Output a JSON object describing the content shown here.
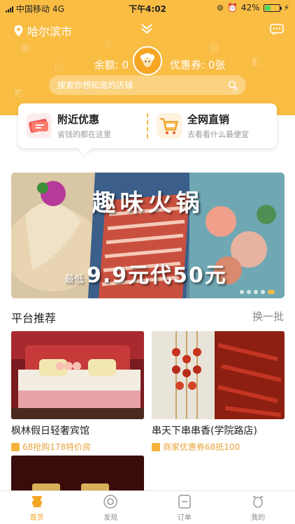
{
  "status_bar": {
    "carrier": "中国移动",
    "network": "4G",
    "time": "下午4:02",
    "battery": "42%",
    "battery_level": 0.42
  },
  "header": {
    "city": "哈尔滨市",
    "balance": "余额: 0",
    "coupons": "优惠券: 0张",
    "search_placeholder": "搜索你想知道的店铺"
  },
  "quick_cards": [
    {
      "title": "附近优惠",
      "subtitle": "省钱的都在这里"
    },
    {
      "title": "全网直销",
      "subtitle": "去看看什么最便宜"
    }
  ],
  "banner": {
    "title": "趣味火锅",
    "sub_prefix": "最低",
    "sub_main": "9.9元代50元"
  },
  "section": {
    "title": "平台推荐",
    "refresh": "换一批"
  },
  "items": [
    {
      "name": "枫林假日轻奢宾馆",
      "promo": "68抢购178特价房"
    },
    {
      "name": "串天下串串香(学院路店)",
      "promo": "商家优惠券68抵100"
    }
  ],
  "tabs": [
    {
      "label": "首页",
      "active": true
    },
    {
      "label": "发现",
      "active": false
    },
    {
      "label": "订单",
      "active": false
    },
    {
      "label": "我的",
      "active": false
    }
  ],
  "colors": {
    "brand": "#f9bd44",
    "accent": "#f5a623",
    "promo": "#e8a53c"
  }
}
